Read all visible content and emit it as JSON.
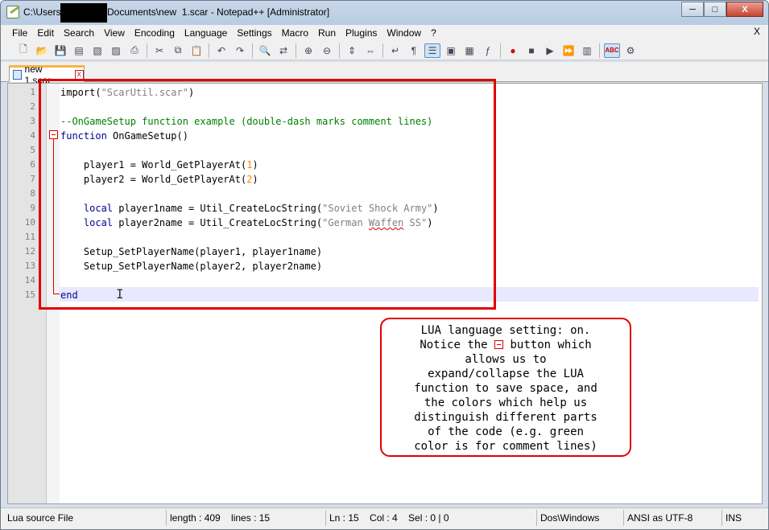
{
  "window": {
    "title_prefix": "C:\\Users",
    "title_suffix": "Documents\\new  1.scar - Notepad++ [Administrator]",
    "min": "─",
    "max": "□",
    "close": "X"
  },
  "menu": {
    "items": [
      "File",
      "Edit",
      "Search",
      "View",
      "Encoding",
      "Language",
      "Settings",
      "Macro",
      "Run",
      "Plugins",
      "Window",
      "?"
    ],
    "close": "X"
  },
  "tab": {
    "label": "new  1.scar",
    "close": "x"
  },
  "editor": {
    "line_numbers": [
      "1",
      "2",
      "3",
      "4",
      "5",
      "6",
      "7",
      "8",
      "9",
      "10",
      "11",
      "12",
      "13",
      "14",
      "15"
    ]
  },
  "note": {
    "lines": [
      "LUA language setting: on.",
      "Notice the",
      "button which",
      "allows us to",
      "expand/collapse the LUA",
      "function to save space, and",
      "the colors which help us",
      "distinguish different parts",
      "of the code (e.g. green",
      "color is for comment lines)"
    ]
  },
  "status": {
    "filetype": "Lua source File",
    "length": "length : 409    lines : 15",
    "position": "Ln : 15    Col : 4    Sel : 0 | 0",
    "eol": "Dos\\Windows",
    "encoding": "ANSI as UTF-8",
    "mode": "INS"
  },
  "colors": {
    "keyword": "#00008b",
    "string": "#808080",
    "number": "#ff8000",
    "comment": "#008000",
    "annotation": "#e00000"
  }
}
